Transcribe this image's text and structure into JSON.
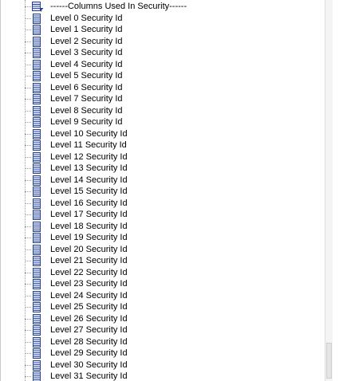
{
  "tree": {
    "header": {
      "label": "------Columns Used In Security------",
      "icon": "table-filter-icon"
    },
    "items": [
      {
        "label": "Level 0 Security Id",
        "icon": "column-icon"
      },
      {
        "label": "Level 1 Security Id",
        "icon": "column-icon"
      },
      {
        "label": "Level 2 Security Id",
        "icon": "column-icon"
      },
      {
        "label": "Level 3 Security Id",
        "icon": "column-icon"
      },
      {
        "label": "Level 4 Security Id",
        "icon": "column-icon"
      },
      {
        "label": "Level 5 Security Id",
        "icon": "column-icon"
      },
      {
        "label": "Level 6 Security Id",
        "icon": "column-icon"
      },
      {
        "label": "Level 7 Security Id",
        "icon": "column-icon"
      },
      {
        "label": "Level 8 Security Id",
        "icon": "column-icon"
      },
      {
        "label": "Level 9 Security Id",
        "icon": "column-icon"
      },
      {
        "label": "Level 10 Security Id",
        "icon": "column-icon"
      },
      {
        "label": "Level 11 Security Id",
        "icon": "column-icon"
      },
      {
        "label": "Level 12 Security Id",
        "icon": "column-icon"
      },
      {
        "label": "Level 13 Security Id",
        "icon": "column-icon"
      },
      {
        "label": "Level 14 Security Id",
        "icon": "column-icon"
      },
      {
        "label": "Level 15 Security Id",
        "icon": "column-icon"
      },
      {
        "label": "Level 16 Security Id",
        "icon": "column-icon"
      },
      {
        "label": "Level 17 Security Id",
        "icon": "column-icon"
      },
      {
        "label": "Level 18 Security Id",
        "icon": "column-icon"
      },
      {
        "label": "Level 19 Security Id",
        "icon": "column-icon"
      },
      {
        "label": "Level 20 Security Id",
        "icon": "column-icon"
      },
      {
        "label": "Level 21 Security Id",
        "icon": "column-icon"
      },
      {
        "label": "Level 22 Security Id",
        "icon": "column-icon"
      },
      {
        "label": "Level 23 Security Id",
        "icon": "column-icon"
      },
      {
        "label": "Level 24 Security Id",
        "icon": "column-icon"
      },
      {
        "label": "Level 25 Security Id",
        "icon": "column-icon"
      },
      {
        "label": "Level 26 Security Id",
        "icon": "column-icon"
      },
      {
        "label": "Level 27 Security Id",
        "icon": "column-icon"
      },
      {
        "label": "Level 28 Security Id",
        "icon": "column-icon"
      },
      {
        "label": "Level 29 Security Id",
        "icon": "column-icon"
      },
      {
        "label": "Level 30 Security Id",
        "icon": "column-icon"
      },
      {
        "label": "Level 31 Security Id",
        "icon": "column-icon"
      }
    ]
  },
  "colors": {
    "icon_fill": "#dfe6f7",
    "icon_stroke": "#2b3f8c",
    "icon_rows": "#3a56b0",
    "filter_accent": "#2b3f8c"
  }
}
